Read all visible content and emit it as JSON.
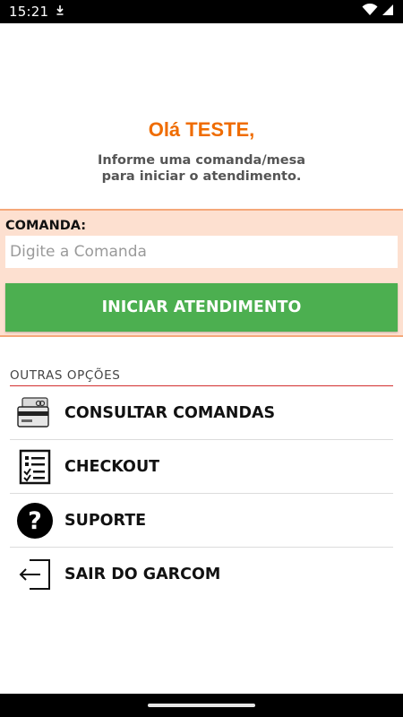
{
  "status_bar": {
    "time": "15:21",
    "icons": [
      "download-icon",
      "wifi-icon",
      "signal-icon"
    ]
  },
  "greeting": {
    "title": "Olá TESTE,",
    "subtitle_line1": "Informe uma comanda/mesa",
    "subtitle_line2": "para iniciar o atendimento."
  },
  "comanda": {
    "label": "COMANDA:",
    "placeholder": "Digite a Comanda",
    "value": "",
    "button_label": "INICIAR ATENDIMENTO"
  },
  "options": {
    "header": "OUTRAS  OPÇÕES",
    "items": [
      {
        "label": "CONSULTAR COMANDAS",
        "icon": "card-icon"
      },
      {
        "label": "CHECKOUT",
        "icon": "checklist-icon"
      },
      {
        "label": "SUPORTE",
        "icon": "help-icon"
      },
      {
        "label": "SAIR DO GARCOM",
        "icon": "logout-icon"
      }
    ]
  },
  "colors": {
    "accent_orange": "#ef6c00",
    "panel_bg": "#fde0d0",
    "button_green": "#4caf50",
    "divider_red": "#d32f2f"
  }
}
